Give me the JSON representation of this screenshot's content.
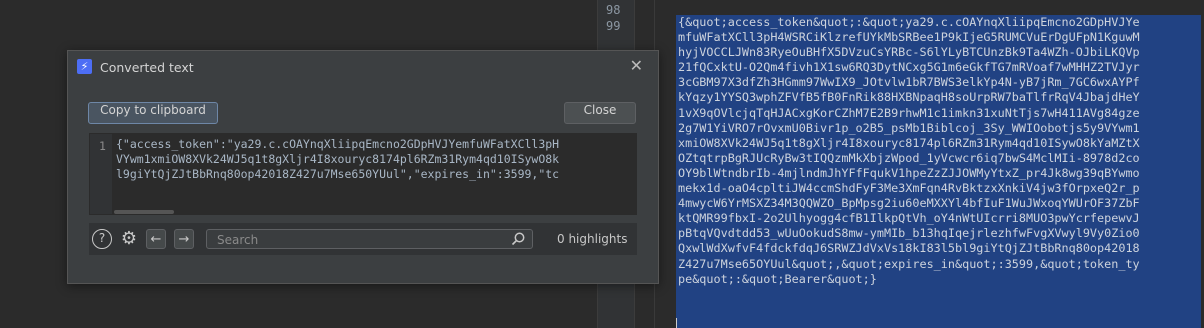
{
  "editor": {
    "line_numbers": [
      "98",
      "99"
    ],
    "selected_text": "{&quot;access_token&quot;:&quot;ya29.c.cOAYnqXliipqEmcno2GDpHVJYe\nmfuWFatXCll3pH4WSRCiKlzrefUYkMbSRBee1P9kIjeG5RUMCVuErDgUFpN1KguwM\nhyjVOCCLJWn83RyeOuBHfX5DVzuCsYRBc-S6lYLyBTCUnzBk9Ta4WZh-OJbiLKQVp\n21fQCxktU-O2Qm4fivh1X1sw6RQ3DytNCxg5G1m6eGkfTG7mRVoaf7wMHHZ2TVJyr\n3cGBM97X3dfZh3HGmm97WwIX9_JOtvlw1bR7BWS3elkYp4N-yB7jRm_7GC6wxAYPf\nkYqzy1YYSQ3wphZFVfB5fB0FnRik88HXBNpaqH8soUrpRW7baTlfrRqV4JbajdHeY\n1vX9qOVlcjqTqHJACxgKorCZhM7E2B9rhwM1c1imkn31xuNtTjs7wH411AVg84gze\n2g7W1YiVRO7rOvxmU0Bivr1p_o2B5_psMb1Biblcoj_3Sy_WWIOobotjs5y9VYwm1\nxmiOW8XVk24WJ5q1t8gXljr4I8xouryc8174pl6RZm31Rym4qd10ISywO8kYaMZtX\nOZtqtrpBgRJUcRyBw3tIQQzmMkXbjzWpod_1yVcwcr6iq7bwS4MclMIi-8978d2co\nOY9blWtndbrIb-4mjlndmJhYFfFqukV1hpeZzZJJOWMyYtxZ_pr4Jk8wg39qBYwmo\nmekx1d-oaO4cpltiJW4ccmShdFyF3Me3XmFqn4RvBktzxXnkiV4jw3fOrpxeQ2r_p\n4mwycW6YrMSXZ34M3QQWZO_BpMpsg2iu60eMXXYl4bfIuF1WuJWxoqYWUrOF37ZbF\nktQMR99fbxI-2o2Ulhyogg4cfB1IlkpQtVh_oY4nWtUIcrri8MUO3pwYcrfepewvJ\npBtqVQvdtdd53_wUuOokudS8mw-ymMIb_b13hqIqejrlezhfwFvgXVwyl9Vy0Zio0\nQxwlWdXwfvF4fdckfdqJ6SRWZJdVxVs18kI83l5bl9giYtQjZJtBbRnq80op42018\nZ427u7Mse65OYUul&quot;,&quot;expires_in&quot;:3599,&quot;token_ty\npe&quot;:&quot;Bearer&quot;}"
  },
  "dialog": {
    "title": "Converted text",
    "app_icon": "lightning-icon",
    "copy_label": "Copy to clipboard",
    "close_label": "Close",
    "code_line_number": "1",
    "code_text": "{\"access_token\":\"ya29.c.cOAYnqXliipqEmcno2GDpHVJYemfuWFatXCll3pH\nVYwm1xmiOW8XVk24WJ5q1t8gXljr4I8xouryc8174pl6RZm31Rym4qd10ISywO8k\nl9giYtQjZJtBbRnq80op42018Z427u7Mse650YUul\",\"expires_in\":3599,\"tc",
    "search_placeholder": "Search",
    "highlights_label": "0 highlights"
  },
  "colors": {
    "selection": "#214283",
    "dialog_bg": "#3c3f41",
    "editor_bg": "#2b2b2b"
  }
}
